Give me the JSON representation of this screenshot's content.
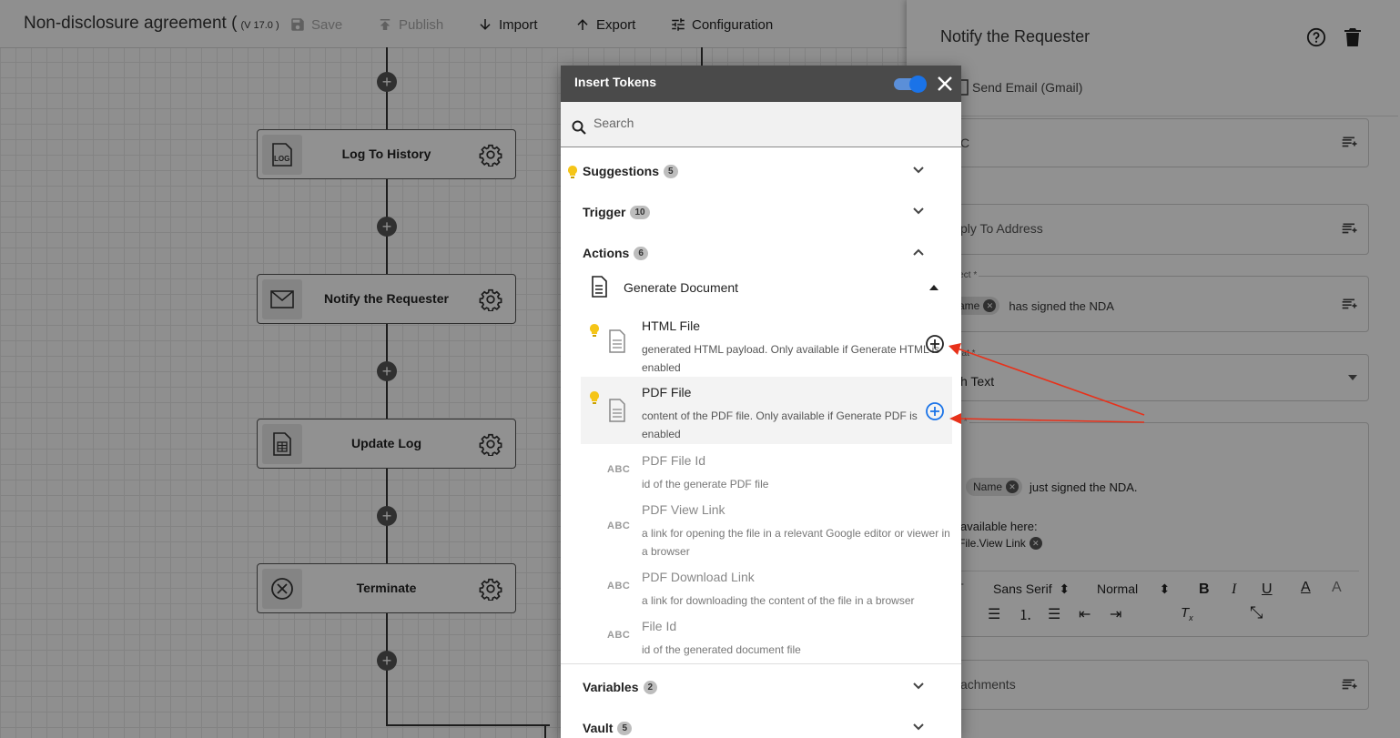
{
  "workflow": {
    "title": "Non-disclosure agreement (",
    "version": "(V 17.0 )",
    "toolbar": {
      "save": "Save",
      "publish": "Publish",
      "import": "Import",
      "export": "Export",
      "configuration": "Configuration"
    },
    "nodes": [
      {
        "label": "Log To History",
        "icon": "log-icon"
      },
      {
        "label": "Notify the Requester",
        "icon": "mail-icon"
      },
      {
        "label": "Update Log",
        "icon": "sheet-icon"
      },
      {
        "label": "Terminate",
        "icon": "terminate-icon"
      }
    ]
  },
  "panel": {
    "title": "Notify the Requester",
    "action": "Send Email (Gmail)",
    "cc_fragment": "C",
    "reply_to_fragment": "ply To Address",
    "subject_label_fragment": "ject *",
    "subject_chip": "ame",
    "subject_text": "has signed the NDA",
    "format_label_fragment": "nat *",
    "format_value_fragment": "h Text",
    "body_label_fragment": "y *",
    "body_chip_name": "Name",
    "body_text_1": "just signed the NDA.",
    "body_text_2": "available here:",
    "body_chip_link": "File.View Link",
    "editor": {
      "font": "Sans Serif",
      "size": "Normal"
    },
    "attachments_fragment": "achments"
  },
  "dialog": {
    "title": "Insert Tokens",
    "toggle_on": true,
    "search_placeholder": "Search",
    "sections": {
      "suggestions": {
        "label": "Suggestions",
        "count": "5"
      },
      "trigger": {
        "label": "Trigger",
        "count": "10"
      },
      "actions": {
        "label": "Actions",
        "count": "6"
      },
      "variables": {
        "label": "Variables",
        "count": "2"
      },
      "vault": {
        "label": "Vault",
        "count": "5"
      }
    },
    "group": "Generate Document",
    "tokens": [
      {
        "name": "HTML File",
        "desc": "generated HTML payload. Only available if Generate HTML is enabled"
      },
      {
        "name": "PDF File",
        "desc": "content of the PDF file. Only available if Generate PDF is enabled"
      },
      {
        "name": "PDF File Id",
        "desc": "id of the generate PDF file",
        "type_label": "ABC"
      },
      {
        "name": "PDF View Link",
        "desc": "a link for opening the file in a relevant Google editor or viewer in a browser",
        "type_label": "ABC"
      },
      {
        "name": "PDF Download Link",
        "desc": "a link for downloading the content of the file in a browser",
        "type_label": "ABC"
      },
      {
        "name": "File Id",
        "desc": "id of the generated document file",
        "type_label": "ABC"
      }
    ]
  },
  "colors": {
    "accent": "#1a73e8",
    "arrow": "#e8311a",
    "bulb": "#f5c518"
  }
}
